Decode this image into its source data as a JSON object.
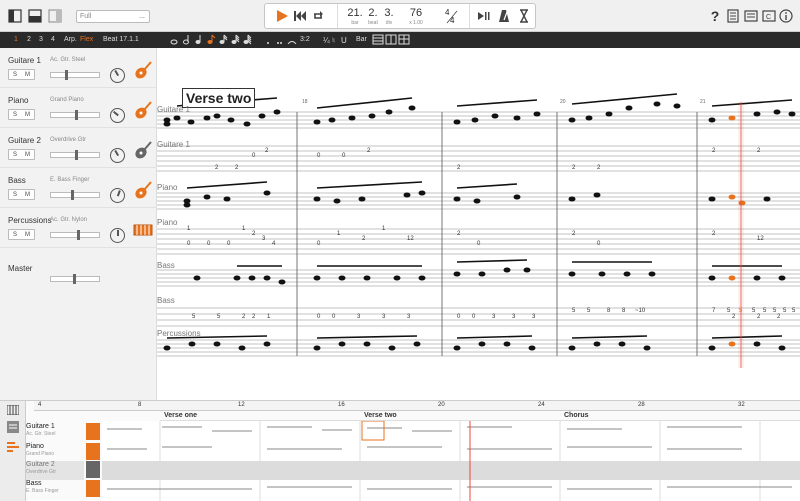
{
  "topbar": {
    "view_value": "Full",
    "view_menu_icon": "...",
    "bar": "21.",
    "bar_label": "bar",
    "beat": "2.",
    "beat_label": "beat",
    "div": "3.",
    "div_label": "div",
    "tempo": "76",
    "tempo_label": "x 1.00",
    "time_sig_top": "4",
    "time_sig_bottom": "4"
  },
  "toolbar2": {
    "items": [
      "1",
      "2",
      "3",
      "4"
    ],
    "arp_label": "Arp.",
    "flex_label": "Flex",
    "beat_label": "Beat 17.1.1",
    "tuplet_label": "3:2",
    "bar_label": "Bar"
  },
  "tracks": [
    {
      "name": "Guitare 1",
      "instrument": "Ac. Gtr. Steel",
      "icon": "guitar-icon",
      "color": "#e8731f"
    },
    {
      "name": "Piano",
      "instrument": "Grand Piano",
      "icon": "piano-icon",
      "color": "#e8731f"
    },
    {
      "name": "Guitare 2",
      "instrument": "Overdrive Gtr",
      "icon": "electric-guitar-icon",
      "color": "#666666"
    },
    {
      "name": "Bass",
      "instrument": "E. Bass Finger",
      "icon": "bass-icon",
      "color": "#e8731f"
    },
    {
      "name": "Percussions",
      "instrument": "Ac. Gtr. Nylon",
      "icon": "drums-icon",
      "color": "#e8731f"
    }
  ],
  "solo_label": "S",
  "mute_label": "M",
  "master_label": "Master",
  "score": {
    "section_title": "Verse two",
    "bar_numbers": [
      "18",
      "20",
      "21"
    ],
    "staff_labels": [
      "Guitare 1",
      "Guitare 1",
      "Piano",
      "Piano",
      "Bass",
      "Bass",
      "Percussions"
    ],
    "tab_numbers_guitar": [
      "2",
      "2",
      "0",
      "2",
      "0",
      "0",
      "2",
      "2",
      "2",
      "2",
      "2",
      "2"
    ],
    "tab_numbers_piano": [
      "1",
      "0",
      "0",
      "0",
      "1",
      "2",
      "3",
      "4",
      "0",
      "1",
      "2",
      "1",
      "12",
      "2",
      "0",
      "2",
      "0",
      "2",
      "12"
    ],
    "tab_numbers_bass": [
      "5",
      "5",
      "2",
      "2",
      "1",
      "0",
      "0",
      "3",
      "3",
      "3",
      "0",
      "0",
      "3",
      "3",
      "3",
      "5",
      "5",
      "8",
      "8",
      "~10",
      "7",
      "2",
      "2",
      "2",
      "5",
      "5",
      "5",
      "5",
      "5",
      "5",
      "5"
    ]
  },
  "timeline": {
    "ruler": [
      "4",
      "8",
      "12",
      "16",
      "20",
      "24",
      "28",
      "32"
    ],
    "markers": [
      "Verse one",
      "Verse two",
      "Chorus"
    ],
    "tracks": [
      {
        "name": "Guitare 1",
        "instrument": "Ac. Gtr. Steel"
      },
      {
        "name": "Piano",
        "instrument": "Grand Piano"
      },
      {
        "name": "Guitare 2",
        "instrument": "Overdrive Gtr"
      },
      {
        "name": "Bass",
        "instrument": "E. Bass Finger"
      }
    ]
  },
  "colors": {
    "accent": "#e8731f",
    "playhead": "#e74c3c"
  }
}
